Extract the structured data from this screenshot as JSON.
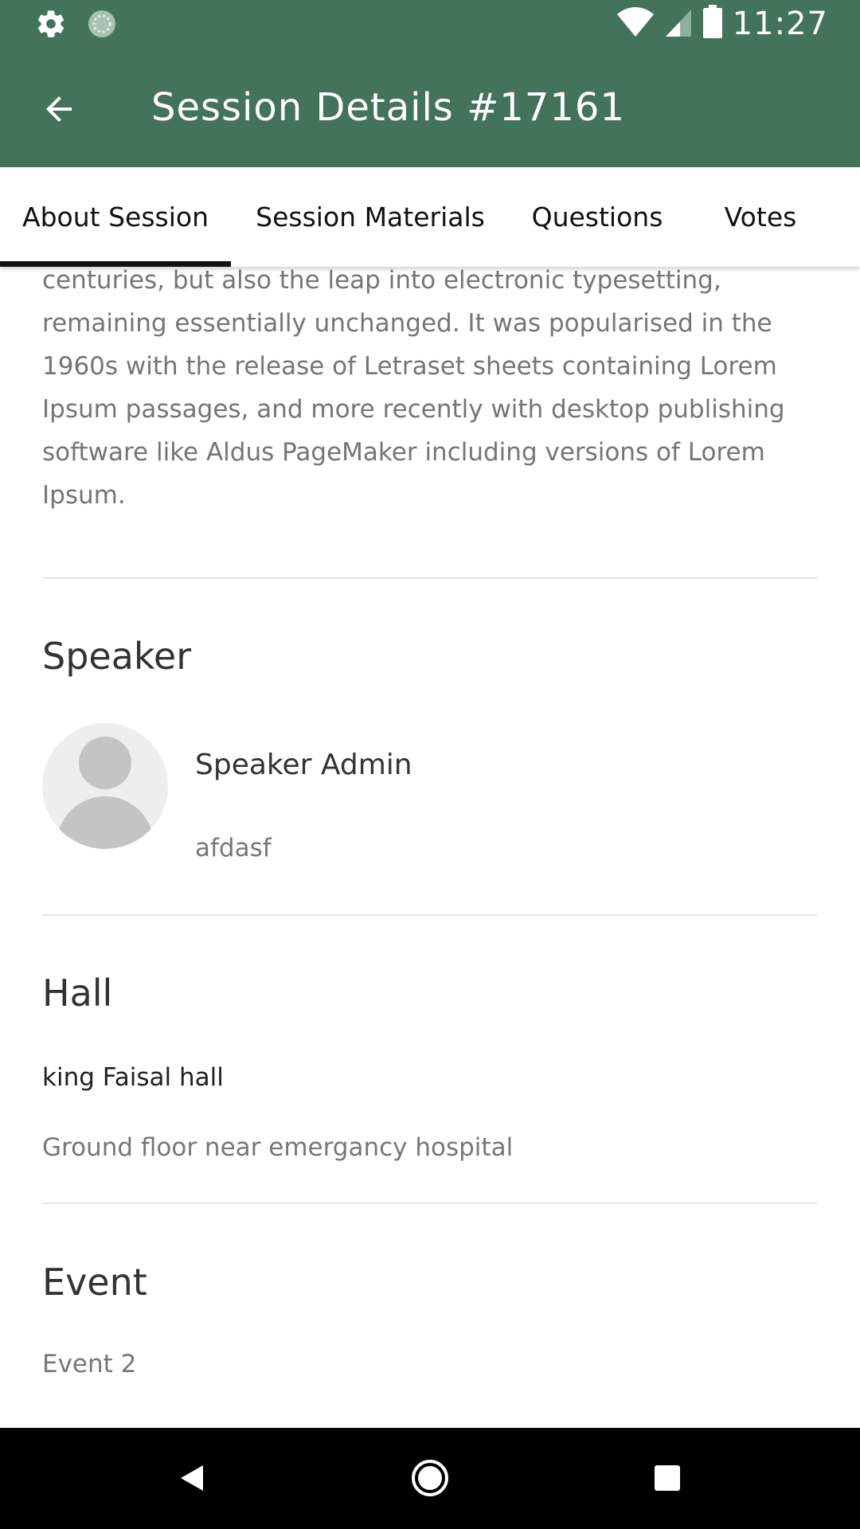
{
  "status_bar": {
    "time": "11:27",
    "left_icons": [
      "gear-icon",
      "sync-icon"
    ],
    "right_icons": [
      "wifi-icon",
      "signal-icon",
      "battery-icon"
    ]
  },
  "app_bar": {
    "title": "Session Details #17161",
    "back_icon": "arrow-back-icon",
    "background": "#43735a"
  },
  "tabs": [
    {
      "label": "About Session",
      "selected": true
    },
    {
      "label": "Session Materials",
      "selected": false
    },
    {
      "label": "Questions",
      "selected": false
    },
    {
      "label": "Votes",
      "selected": false
    }
  ],
  "description": {
    "lines": [
      "centuries, but also the leap into electronic typesetting,",
      "remaining essentially unchanged. It was popularised in the",
      "1960s with the release of Letraset sheets containing Lorem",
      "Ipsum passages, and more recently with desktop publishing",
      "software like Aldus PageMaker including versions of Lorem",
      "Ipsum."
    ]
  },
  "speaker": {
    "section_title": "Speaker",
    "name": "Speaker Admin",
    "subtitle": "afdasf",
    "avatar_icon": "person-placeholder-icon"
  },
  "hall": {
    "section_title": "Hall",
    "name": "king Faisal hall",
    "description": "Ground floor near emergancy hospital"
  },
  "event": {
    "section_title": "Event",
    "name": "Event 2"
  },
  "nav_bar": {
    "buttons": [
      "back-triangle-icon",
      "home-circle-icon",
      "recents-square-icon"
    ]
  }
}
